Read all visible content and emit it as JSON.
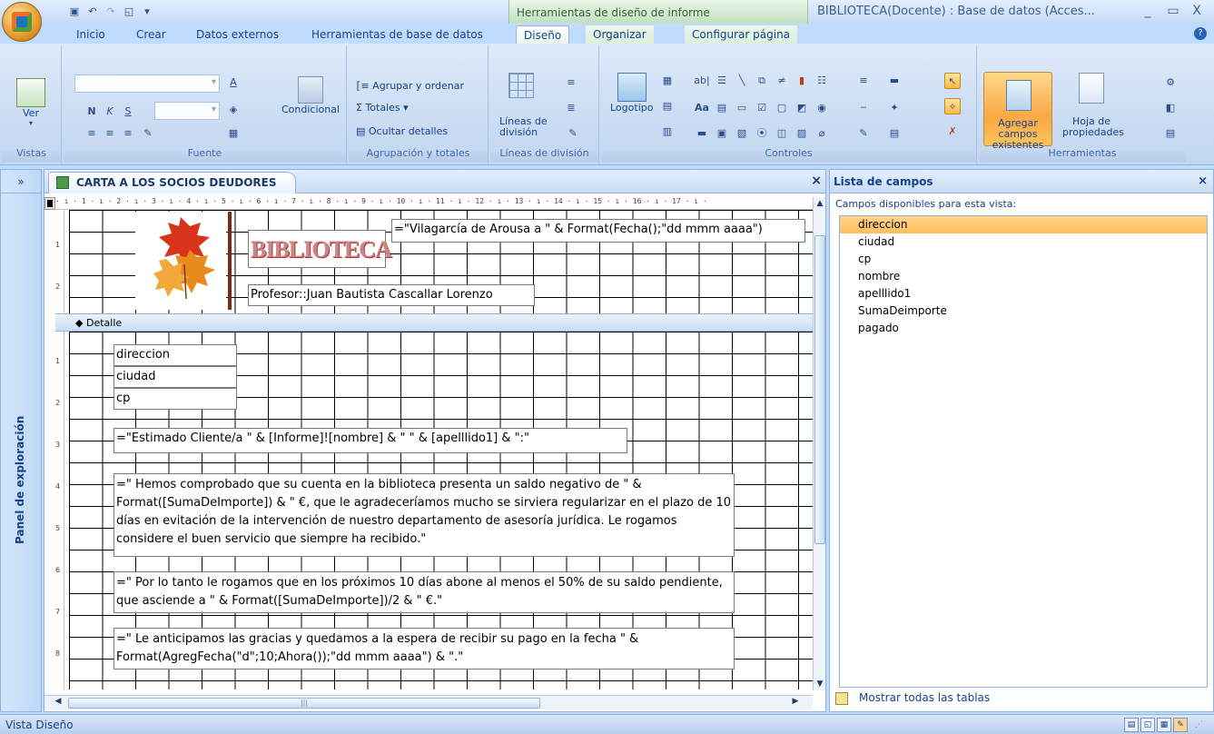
{
  "window": {
    "title": "BIBLIOTECA(Docente) : Base de datos (Acces...",
    "context_tab_title": "Herramientas de diseño de informe",
    "minimize": "_",
    "maximize": "▭",
    "close": "X"
  },
  "tabs": [
    {
      "label": "Inicio"
    },
    {
      "label": "Crear"
    },
    {
      "label": "Datos externos"
    },
    {
      "label": "Herramientas de base de datos"
    },
    {
      "label": "Diseño"
    },
    {
      "label": "Organizar"
    },
    {
      "label": "Configurar página"
    }
  ],
  "ribbon": {
    "vistas": {
      "group_label": "Vistas",
      "ver_label": "Ver"
    },
    "fuente": {
      "group_label": "Fuente",
      "condicional_label": "Condicional",
      "bold": "N",
      "italic": "K",
      "underline": "S"
    },
    "agrupacion": {
      "group_label": "Agrupación y totales",
      "agrupar": "Agrupar y ordenar",
      "totales": "Totales",
      "ocultar": "Ocultar detalles"
    },
    "lineas": {
      "group_label": "Líneas de división",
      "lineas_btn_1": "Líneas de",
      "lineas_btn_2": "división"
    },
    "controles": {
      "group_label": "Controles",
      "logotipo": "Logotipo"
    },
    "herramientas": {
      "group_label": "Herramientas",
      "agregar_1": "Agregar campos",
      "agregar_2": "existentes",
      "hoja_1": "Hoja de",
      "hoja_2": "propiedades"
    }
  },
  "navpane": {
    "label": "Panel de exploración",
    "toggle": "»"
  },
  "document": {
    "tab_title": "CARTA A LOS SOCIOS DEUDORES",
    "close": "×",
    "ruler": "· ı · 1 · ı · 2 · ı · 3 · ı · 4 · ı · 5 · ı · 6 · ı · 7 · ı · 8 · ı · 9 · ı · 10 · ı · 11 · ı · 12 · ı · 13 · ı · 14 · ı · 15 · ı · 16 · ı · 17 · ı ·",
    "header": {
      "biblioteca": "BIBLIOTECA",
      "fecha_expr": "=\"Vilagarcía de Arousa a \" & Format(Fecha();\"dd mmm aaaa\")",
      "profesor": "Profesor::Juan Bautista Cascallar Lorenzo",
      "ruler_marks": [
        "1",
        "2"
      ]
    },
    "detalle_label": "Detalle",
    "detail_ruler_marks": [
      "1",
      "2",
      "3",
      "4",
      "5",
      "6",
      "7",
      "8"
    ],
    "fields": {
      "direccion": "direccion",
      "ciudad": "ciudad",
      "cp": "cp"
    },
    "saludo_expr": "=\"Estimado Cliente/a \" & [Informe]![nombre] & \" \" & [apelllido1] & \":\"",
    "parrafo1": "=\"     Hemos comprobado que su cuenta en la biblioteca presenta un saldo negativo de \" & Format([SumaDeImporte]) & \" €, que le agradeceríamos mucho se sirviera regularizar en el plazo de 10 días en evitación de la intervención de nuestro departamento de asesoría jurídica. Le rogamos considere el buen servicio que siempre ha recibido.\"",
    "parrafo2": "=\"     Por lo tanto le rogamos que en los próximos 10 días abone al menos el 50% de su saldo pendiente, que asciende a \" & Format([SumaDeImporte])/2 & \" €.\"",
    "parrafo3": "=\"     Le anticipamos las gracias y quedamos a la espera de recibir su pago en la fecha \" & Format(AgregFecha(\"d\";10;Ahora());\"dd mmm aaaa\") & \".\""
  },
  "fieldlist": {
    "title": "Lista de campos",
    "close": "×",
    "subtitle": "Campos disponibles para esta vista:",
    "items": [
      "direccion",
      "ciudad",
      "cp",
      "nombre",
      "apelllido1",
      "SumaDeimporte",
      "pagado"
    ],
    "selected_index": 0,
    "footer": "Mostrar todas las tablas"
  },
  "status": {
    "text": "Vista Diseño"
  },
  "colors": {
    "ribbon_bg": "#c9dbf2",
    "accent_orange": "#f9a844",
    "selection": "#ffbf5c"
  }
}
